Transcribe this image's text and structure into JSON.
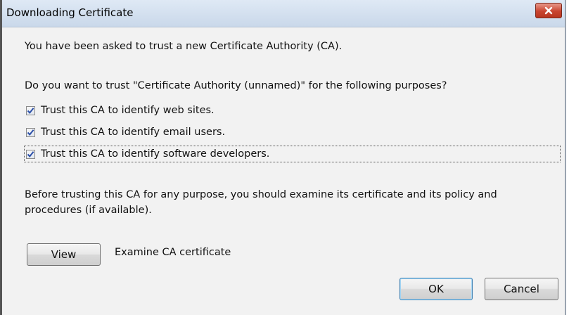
{
  "window": {
    "title": "Downloading Certificate",
    "close_icon": "close-icon"
  },
  "intro_text": "You have been asked to trust a new Certificate Authority (CA).",
  "question_text": "Do you want to trust \"Certificate Authority (unnamed)\" for the following purposes?",
  "purposes": [
    {
      "label": "Trust this CA to identify web sites.",
      "checked": true
    },
    {
      "label": "Trust this CA to identify email users.",
      "checked": true
    },
    {
      "label": "Trust this CA to identify software developers.",
      "checked": true
    }
  ],
  "advice_text_line1": "Before trusting this CA for any purpose, you should examine its certificate and its policy and",
  "advice_text_line2": "procedures (if available).",
  "view_button_label": "View",
  "view_description": "Examine CA certificate",
  "ok_button_label": "OK",
  "cancel_button_label": "Cancel",
  "colors": {
    "checkmark": "#2b4fa8",
    "close_button": "#c94430",
    "titlebar": "#c9d8ea"
  }
}
